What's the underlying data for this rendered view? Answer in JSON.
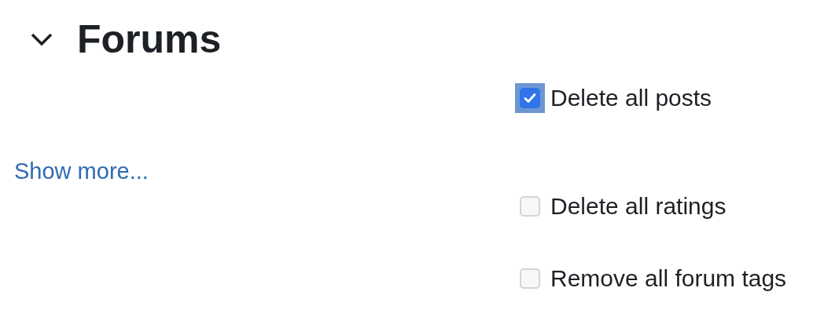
{
  "section": {
    "title": "Forums",
    "expanded": true
  },
  "show_more": {
    "label": "Show more..."
  },
  "options": [
    {
      "label": "Delete all posts",
      "checked": true,
      "focused": true
    },
    {
      "label": "Delete all ratings",
      "checked": false,
      "focused": false
    },
    {
      "label": "Remove all forum tags",
      "checked": false,
      "focused": false
    }
  ]
}
